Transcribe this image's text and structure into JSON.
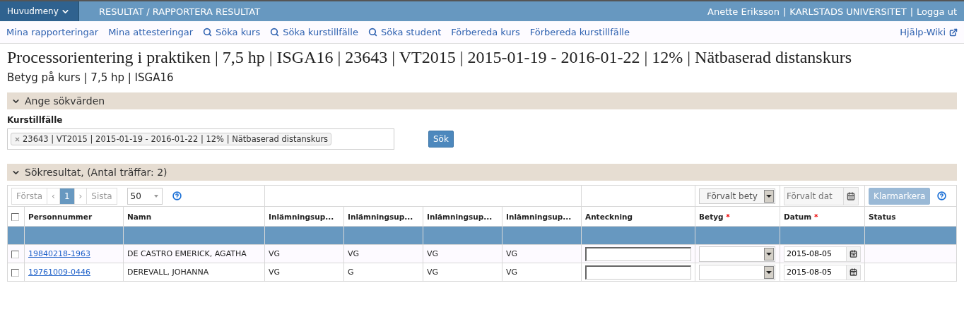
{
  "topbar": {
    "menu_button": "Huvudmeny",
    "breadcrumb": "RESULTAT / RAPPORTERA RESULTAT",
    "user": "Anette Eriksson",
    "separator_1": "|",
    "organisation": "KARLSTADS UNIVERSITET",
    "separator_2": "|",
    "logout": "Logga ut"
  },
  "nav": {
    "links": [
      {
        "label": "Mina rapporteringar",
        "kind": "link"
      },
      {
        "label": "Mina attesteringar",
        "kind": "link"
      },
      {
        "label": "Söka kurs",
        "kind": "search"
      },
      {
        "label": "Söka kurstillfälle",
        "kind": "search"
      },
      {
        "label": "Söka student",
        "kind": "search"
      },
      {
        "label": "Förbereda kurs",
        "kind": "link"
      },
      {
        "label": "Förbereda kurstillfälle",
        "kind": "link"
      }
    ],
    "help": "Hjälp-Wiki"
  },
  "title": "Processorientering i praktiken | 7,5 hp | ISGA16 | 23643 | VT2015 | 2015-01-19 - 2016-01-22 | 12% | Nätbaserad distanskurs",
  "subtitle": "Betyg på kurs | 7,5 hp | ISGA16",
  "search_panel": {
    "heading": "Ange sökvärden",
    "expanded": true,
    "field_label": "Kurstillfälle",
    "tag": "23643 | VT2015 | 2015-01-19 - 2016-01-22 | 12% | Nätbaserad distanskurs",
    "button": "Sök"
  },
  "results": {
    "heading": "Sökresultat, (Antal träffar: 2)",
    "expanded": true,
    "pager": {
      "first": "Första",
      "prev": "‹",
      "pages": [
        {
          "label": "1",
          "selected": true
        }
      ],
      "next": "›",
      "last": "Sista",
      "page_size": "50"
    },
    "default_grade": {
      "placeholder": "Förvalt bety"
    },
    "default_date": {
      "placeholder": "Förvalt dat"
    },
    "mark_button": {
      "label": "Klarmarkera",
      "disabled": true
    },
    "select_all": {
      "checked": false
    },
    "columns": [
      {
        "label": "Personnummer"
      },
      {
        "label": "Namn"
      },
      {
        "label": "Inlämningsup..."
      },
      {
        "label": "Inlämningsup..."
      },
      {
        "label": "Inlämningsup..."
      },
      {
        "label": "Inlämningsup..."
      },
      {
        "label": "Anteckning"
      },
      {
        "label": "Betyg",
        "required_mark": "*"
      },
      {
        "label": "Datum",
        "required_mark": "*"
      },
      {
        "label": "Status"
      }
    ],
    "rows": [
      {
        "checked": false,
        "personnummer": "19840218-1963",
        "name": "DE CASTRO EMERICK, AGATHA",
        "grades": [
          "VG",
          "VG",
          "VG",
          "VG"
        ],
        "date": "2015-08-05"
      },
      {
        "checked": false,
        "personnummer": "19761009-0446",
        "name": "DEREVALL, JOHANNA",
        "grades": [
          "VG",
          "G",
          "VG",
          "VG"
        ],
        "date": "2015-08-05"
      }
    ]
  }
}
